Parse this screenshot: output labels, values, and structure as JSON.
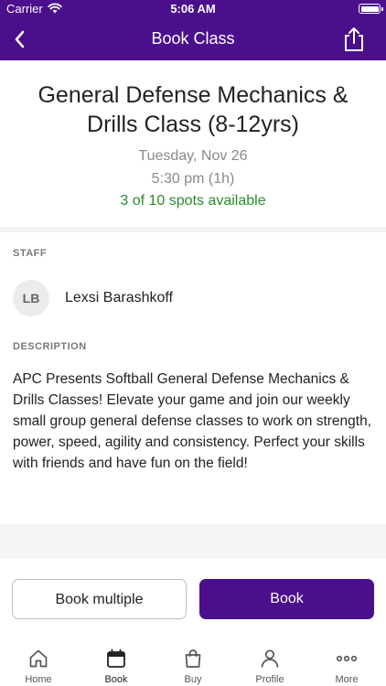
{
  "status_bar": {
    "carrier": "Carrier",
    "time": "5:06 AM"
  },
  "nav": {
    "title": "Book Class",
    "back_icon": "chevron-left-icon",
    "share_icon": "share-icon"
  },
  "class": {
    "title": "General Defense Mechanics & Drills Class (8-12yrs)",
    "date": "Tuesday, Nov 26",
    "time": "5:30 pm (1h)",
    "spots": "3 of 10 spots available",
    "spots_color": "#2c8a2c"
  },
  "staff": {
    "label": "STAFF",
    "initials": "LB",
    "name": "Lexsi Barashkoff"
  },
  "description": {
    "label": "DESCRIPTION",
    "text": "APC Presents Softball General Defense Mechanics & Drills Classes! Elevate your game and join our weekly small group general defense classes to work on strength, power, speed, agility and consistency. Perfect your skills with friends and have fun on the field!"
  },
  "actions": {
    "book_multiple": "Book multiple",
    "book": "Book"
  },
  "tabs": [
    {
      "label": "Home",
      "icon": "home-icon"
    },
    {
      "label": "Book",
      "icon": "calendar-icon",
      "active": true
    },
    {
      "label": "Buy",
      "icon": "shopping-bag-icon"
    },
    {
      "label": "Profile",
      "icon": "person-icon"
    },
    {
      "label": "More",
      "icon": "more-dots-icon"
    }
  ],
  "colors": {
    "brand": "#4b0f8c"
  }
}
